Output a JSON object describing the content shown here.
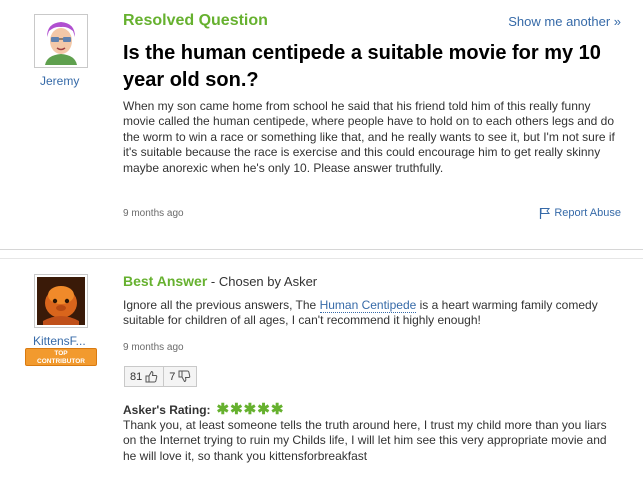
{
  "question": {
    "status_label": "Resolved Question",
    "show_another": "Show me another »",
    "asker_name": "Jeremy",
    "title": "Is the human centipede a suitable movie for my 10 year old son.?",
    "body": "When my son came home from school he said that his friend told him of this really funny movie called the human centipede, where people have to hold on to each others legs and do the worm to win a race or something like that, and he really wants to see it, but I'm not sure if it's suitable because the race is exercise and this could encourage him to get really skinny maybe anorexic when he's only 10. Please answer truthfully.",
    "time": "9 months ago",
    "report_label": "Report Abuse"
  },
  "best_answer": {
    "label": "Best Answer",
    "chosen_by": " - Chosen by Asker",
    "answerer_name": "KittensF...",
    "badge_line1": "TOP",
    "badge_line2": "CONTRIBUTOR",
    "body_before": "Ignore all the previous answers, The ",
    "body_link": "Human Centipede",
    "body_after": " is a heart warming family comedy suitable for children of all ages, I can't recommend it highly enough!",
    "time": "9 months ago",
    "thumbs_up_count": "81",
    "thumbs_down_count": "7",
    "rating_label": "Asker's Rating:",
    "rating_stars": "✱✱✱✱✱",
    "rating_value": 5,
    "rating_comment": "Thank you, at least someone tells the truth around here, I trust my child more than you liars on the Internet trying to ruin my Childs life, I will let him see this very appropriate movie and he will love it, so thank you kittensforbreakfast"
  },
  "colors": {
    "accent_green": "#66b12f",
    "link_blue": "#366aa8",
    "badge_orange": "#f29a2e"
  }
}
